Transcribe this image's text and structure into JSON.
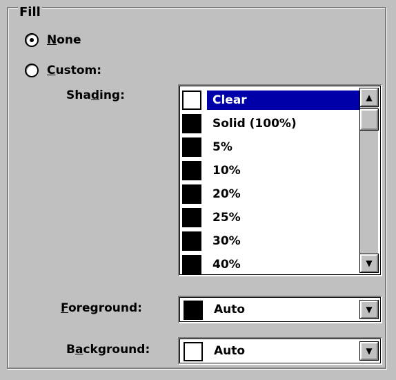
{
  "fill": {
    "group_title": "Fill",
    "none_label_u": "N",
    "none_label_rest": "one",
    "custom_label_u": "C",
    "custom_label_rest": "ustom:",
    "selected_option": "None"
  },
  "shading": {
    "label_pre": "Sha",
    "label_u": "d",
    "label_post": "ing:",
    "items": [
      {
        "text": "Clear",
        "swatch": "white",
        "selected": true
      },
      {
        "text": "Solid (100%)",
        "swatch": "black"
      },
      {
        "text": "5%",
        "swatch": "black"
      },
      {
        "text": "10%",
        "swatch": "black"
      },
      {
        "text": "20%",
        "swatch": "black"
      },
      {
        "text": "25%",
        "swatch": "black"
      },
      {
        "text": "30%",
        "swatch": "black"
      },
      {
        "text": "40%",
        "swatch": "black"
      }
    ]
  },
  "foreground": {
    "label_u": "F",
    "label_rest": "oreground:",
    "value": "Auto",
    "swatch": "black"
  },
  "background": {
    "label_pre": "B",
    "label_u": "a",
    "label_post": "ckground:",
    "value": "Auto",
    "swatch": "white"
  },
  "icons": {
    "scroll_up": "▲",
    "scroll_down": "▼",
    "dropdown": "▼"
  }
}
